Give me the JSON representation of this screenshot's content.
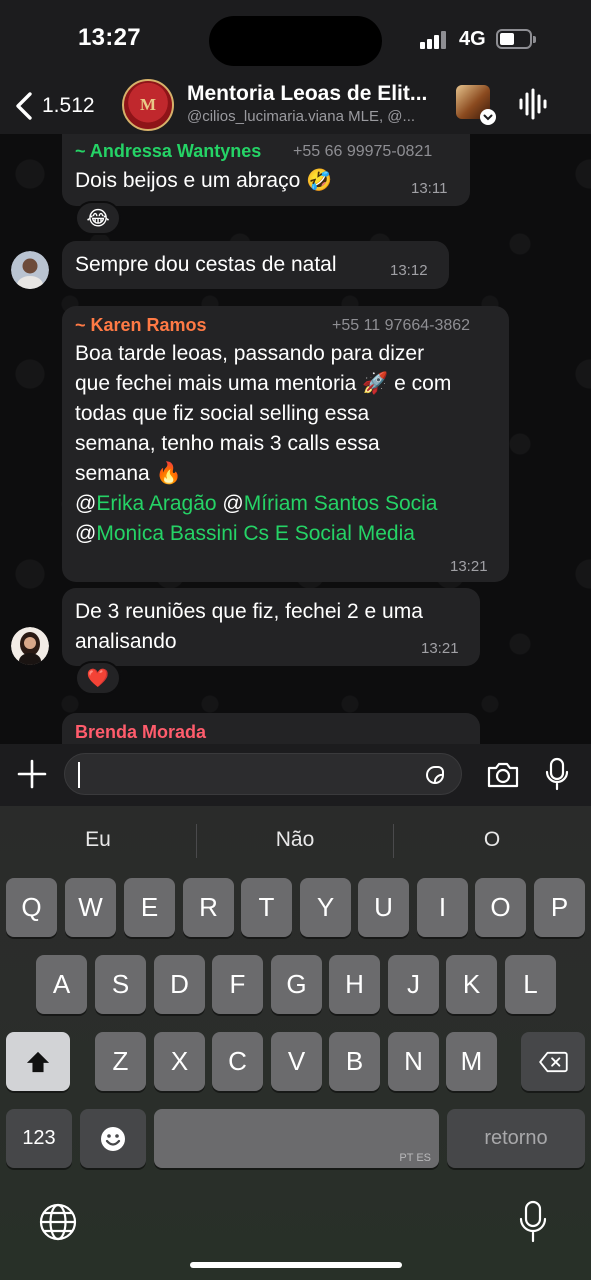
{
  "status_bar": {
    "time": "13:27",
    "network": "4G"
  },
  "header": {
    "back_count": "1.512",
    "title": "Mentoria Leoas de Elit...",
    "subtitle": "@cilios_lucimaria.viana MLE, @..."
  },
  "messages": [
    {
      "sender": "~ Andressa Wantynes",
      "phone": "+55 66 99975-0821",
      "lines": [
        "Dois beijos e um abraço 🤣"
      ],
      "time": "13:11",
      "reaction": "😂"
    },
    {
      "lines": [
        "Sempre dou cestas  de natal"
      ],
      "time": "13:12"
    },
    {
      "sender": "~ Karen Ramos",
      "phone": "+55 11 97664-3862",
      "lines": [
        "Boa tarde leoas, passando para dizer",
        "que fechei mais uma mentoria 🚀  e com",
        "todas que fiz social selling essa",
        "semana, tenho mais 3 calls essa",
        "semana 🔥"
      ],
      "mentions": [
        {
          "at": "@",
          "name1": "Erika Aragão",
          "name2": "Míriam Santos  Socia"
        },
        {
          "at": "@",
          "name1": "Monica Bassini Cs E Social Media"
        }
      ],
      "time": "13:21"
    },
    {
      "lines": [
        "De 3 reuniões que fiz, fechei 2 e uma",
        "analisando"
      ],
      "time": "13:21",
      "reaction": "❤️"
    },
    {
      "sender": "Brenda Morada"
    }
  ],
  "input": {
    "placeholder": ""
  },
  "keyboard": {
    "suggestions": [
      "Eu",
      "Não",
      "O"
    ],
    "row1": [
      "Q",
      "W",
      "E",
      "R",
      "T",
      "Y",
      "U",
      "I",
      "O",
      "P"
    ],
    "row2": [
      "A",
      "S",
      "D",
      "F",
      "G",
      "H",
      "J",
      "K",
      "L"
    ],
    "row3": [
      "Z",
      "X",
      "C",
      "V",
      "B",
      "N",
      "M"
    ],
    "numbers_label": "123",
    "return_label": "retorno",
    "space_hint": "PT ES"
  },
  "colors": {
    "andressa_name": "#25d366",
    "karen_name": "#ff7a45",
    "brenda_name": "#ff5c6c",
    "mention": "#25d366",
    "bubble": "#232325"
  }
}
